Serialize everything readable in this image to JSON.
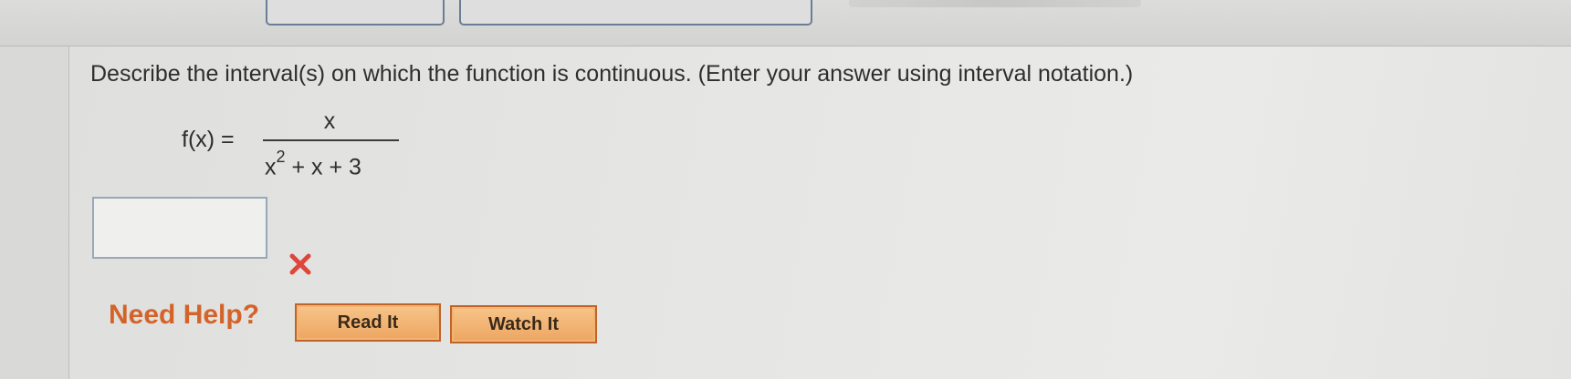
{
  "question": {
    "prompt": "Describe the interval(s) on which the function is continuous. (Enter your answer using interval notation.)",
    "function_lhs": "f(x) =",
    "numerator": "x",
    "denominator_base": "x",
    "denominator_exponent": "2",
    "denominator_rest": "+ x + 3"
  },
  "answer": {
    "value": "",
    "status": "incorrect",
    "status_icon": "red-x-icon",
    "status_color": "#e0453b"
  },
  "help": {
    "label": "Need Help?",
    "read_it": "Read It",
    "watch_it": "Watch It",
    "label_color": "#d4632a",
    "button_color": "#eda561"
  }
}
